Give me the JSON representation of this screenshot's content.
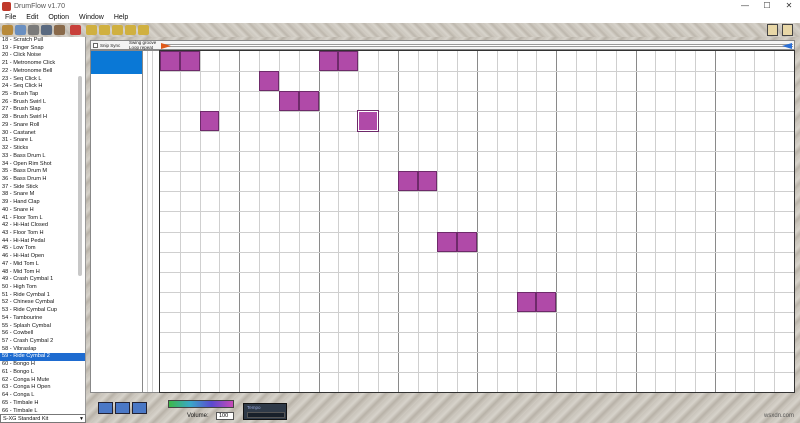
{
  "window": {
    "title": "DrumFlow v1.70",
    "controls": {
      "minimize": "—",
      "maximize": "☐",
      "close": "✕"
    }
  },
  "menu": [
    "File",
    "Edit",
    "Option",
    "Window",
    "Help"
  ],
  "header": {
    "checkbox_label": "Snip Sync",
    "swing_label": "Swing groove",
    "loop_label": "Loop repeat"
  },
  "instruments": [
    "18 - Scratch Pull",
    "19 - Finger Snap",
    "20 - Click Noise",
    "21 - Metronome Click",
    "22 - Metronome Bell",
    "23 - Seq Click L",
    "24 - Seq Click H",
    "25 - Brush Tap",
    "26 - Brush Swirl L",
    "27 - Brush Slap",
    "28 - Brush Swirl H",
    "29 - Snare Roll",
    "30 - Castanet",
    "31 - Snare L",
    "32 - Sticks",
    "33 - Bass Drum L",
    "34 - Open Rim Shot",
    "35 - Bass Drum M",
    "36 - Bass Drum H",
    "37 - Side Stick",
    "38 - Snare M",
    "39 - Hand Clap",
    "40 - Snare H",
    "41 - Floor Tom L",
    "42 - Hi-Hat Closed",
    "43 - Floor Tom H",
    "44 - Hi-Hat Pedal",
    "45 - Low Tom",
    "46 - Hi-Hat Open",
    "47 - Mid Tom L",
    "48 - Mid Tom H",
    "49 - Crash Cymbal 1",
    "50 - High Tom",
    "51 - Ride Cymbal 1",
    "52 - Chinese Cymbal",
    "53 - Ride Cymbal Cup",
    "54 - Tambourine",
    "55 - Splash Cymbal",
    "56 - Cowbell",
    "57 - Crash Cymbal 2",
    "58 - Vibraslap",
    "59 - Ride Cymbal 2",
    "60 - Bongo H",
    "61 - Bongo L",
    "62 - Conga H Mute",
    "63 - Conga H Open",
    "64 - Conga L",
    "65 - Timbale H",
    "66 - Timbale L",
    "67 - Agogo H",
    "68 - Agogo L"
  ],
  "selected_instrument": "59 - Ride Cymbal 2",
  "kit": "S-XG Standard Kit",
  "volume": {
    "label": "Volume:",
    "value": "100"
  },
  "tempo": {
    "label": "Tempo"
  },
  "watermark": "wsxdn.com",
  "grid": {
    "columns": 32,
    "rows": 17,
    "notes": [
      {
        "row": 0,
        "col": 0
      },
      {
        "row": 0,
        "col": 1
      },
      {
        "row": 0,
        "col": 8
      },
      {
        "row": 0,
        "col": 9
      },
      {
        "row": 1,
        "col": 5
      },
      {
        "row": 2,
        "col": 6
      },
      {
        "row": 2,
        "col": 7
      },
      {
        "row": 3,
        "col": 2
      },
      {
        "row": 3,
        "col": 10
      },
      {
        "row": 6,
        "col": 12
      },
      {
        "row": 6,
        "col": 13
      },
      {
        "row": 9,
        "col": 14
      },
      {
        "row": 9,
        "col": 15
      },
      {
        "row": 12,
        "col": 18
      },
      {
        "row": 12,
        "col": 19
      }
    ]
  }
}
